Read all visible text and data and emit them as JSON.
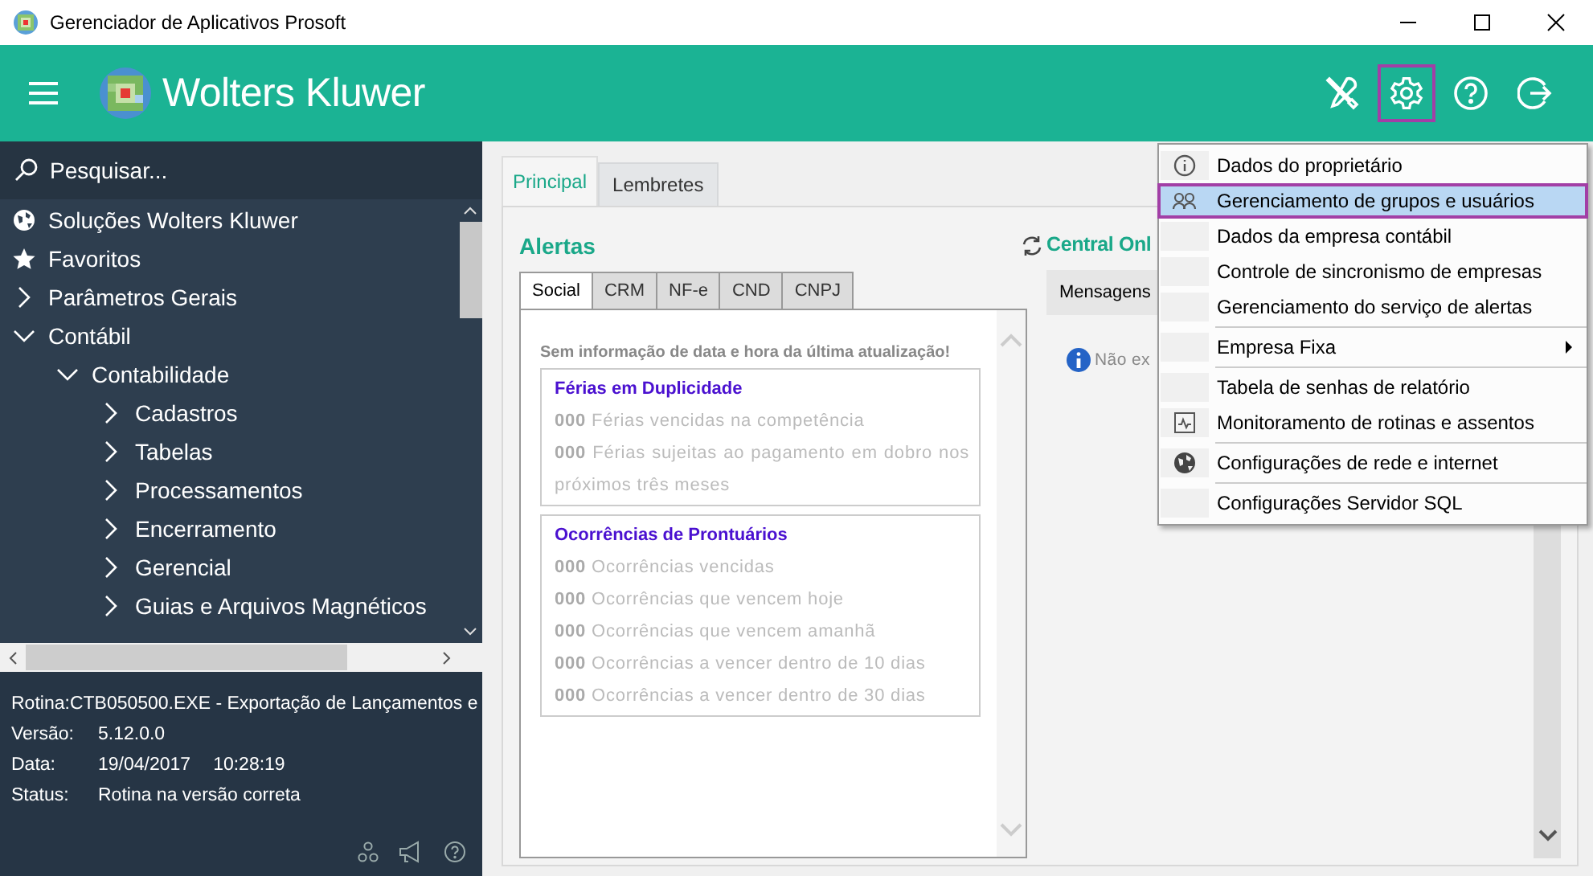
{
  "window": {
    "title": "Gerenciador de Aplicativos Prosoft"
  },
  "header": {
    "brand": "Wolters Kluwer",
    "actions": [
      {
        "kind": "tools",
        "highlighted": false
      },
      {
        "kind": "settings",
        "highlighted": true
      },
      {
        "kind": "help",
        "highlighted": false
      },
      {
        "kind": "exit",
        "highlighted": false
      }
    ]
  },
  "sidebar": {
    "search": {
      "placeholder": "Pesquisar..."
    },
    "tree": [
      {
        "label": "Soluções Wolters Kluwer",
        "kind": "globe"
      },
      {
        "label": "Favoritos",
        "kind": "star"
      },
      {
        "label": "Parâmetros Gerais",
        "kind": "folder",
        "expanded": false
      },
      {
        "label": "Contábil",
        "kind": "folder",
        "expanded": true,
        "children": [
          {
            "label": "Contabilidade",
            "kind": "folder",
            "expanded": true,
            "children": [
              {
                "label": "Cadastros",
                "kind": "folder",
                "expanded": false
              },
              {
                "label": "Tabelas",
                "kind": "folder",
                "expanded": false
              },
              {
                "label": "Processamentos",
                "kind": "folder",
                "expanded": false
              },
              {
                "label": "Encerramento",
                "kind": "folder",
                "expanded": false
              },
              {
                "label": "Gerencial",
                "kind": "folder",
                "expanded": false
              },
              {
                "label": "Guias e Arquivos Magnéticos",
                "kind": "folder",
                "expanded": false
              }
            ]
          }
        ]
      }
    ],
    "details": [
      {
        "label": "Rotina:",
        "values": [
          "CTB050500.EXE - Exportação de Lançamentos e"
        ]
      },
      {
        "label": "Versão:",
        "values": [
          "5.12.0.0"
        ]
      },
      {
        "label": "Data:",
        "values": [
          "19/04/2017",
          "10:28:19"
        ]
      },
      {
        "label": "Status:",
        "values": [
          "Rotina na versão correta"
        ]
      }
    ]
  },
  "tabs": [
    {
      "label": "Principal",
      "selected": true
    },
    {
      "label": "Lembretes",
      "selected": false
    }
  ],
  "alerts": {
    "title": "Alertas",
    "tabs": [
      {
        "label": "Social",
        "selected": true
      },
      {
        "label": "CRM",
        "selected": false
      },
      {
        "label": "NF-e",
        "selected": false
      },
      {
        "label": "CND",
        "selected": false
      },
      {
        "label": "CNPJ",
        "selected": false
      }
    ],
    "notice": "Sem informação de data e hora da última atualização!",
    "groups": [
      {
        "title": "Férias em Duplicidade",
        "lines": [
          "**000** Férias vencidas na competência",
          "**000** Férias sujeitas ao pagamento em dobro nos próximos três meses"
        ]
      },
      {
        "title": "Ocorrências de Prontuários",
        "lines": [
          "**000** Ocorrências vencidas",
          "**000** Ocorrências que vencem hoje",
          "**000** Ocorrências que vencem amanhã",
          "**000** Ocorrências a vencer dentro de 10 dias",
          "**000** Ocorrências a vencer dentro de 30 dias"
        ]
      }
    ]
  },
  "central": {
    "title": "Central Onl",
    "tab": "Mensagens",
    "message": "Não ex"
  },
  "menu": {
    "items": [
      {
        "label": "Dados do proprietário",
        "kind": "info",
        "selected": false,
        "separator_before": false,
        "submenu": false
      },
      {
        "label": "Gerenciamento de grupos e usuários",
        "kind": "users",
        "selected": true,
        "separator_before": false,
        "submenu": false
      },
      {
        "label": "Dados da empresa contábil",
        "kind": "plain",
        "selected": false,
        "separator_before": false,
        "submenu": false
      },
      {
        "label": "Controle de sincronismo de empresas",
        "kind": "plain",
        "selected": false,
        "separator_before": false,
        "submenu": false
      },
      {
        "label": "Gerenciamento do serviço de alertas",
        "kind": "plain",
        "selected": false,
        "separator_before": false,
        "submenu": false
      },
      {
        "label": "Empresa Fixa",
        "kind": "plain",
        "selected": false,
        "separator_before": true,
        "submenu": true
      },
      {
        "label": "Tabela de senhas de relatório",
        "kind": "plain",
        "selected": false,
        "separator_before": true,
        "submenu": false
      },
      {
        "label": "Monitoramento de rotinas e assentos",
        "kind": "monitor",
        "selected": false,
        "separator_before": false,
        "submenu": false
      },
      {
        "label": "Configurações de rede e internet",
        "kind": "globe",
        "selected": false,
        "separator_before": true,
        "submenu": false
      },
      {
        "label": "Configurações Servidor SQL",
        "kind": "plain",
        "selected": false,
        "separator_before": true,
        "submenu": false
      }
    ]
  }
}
